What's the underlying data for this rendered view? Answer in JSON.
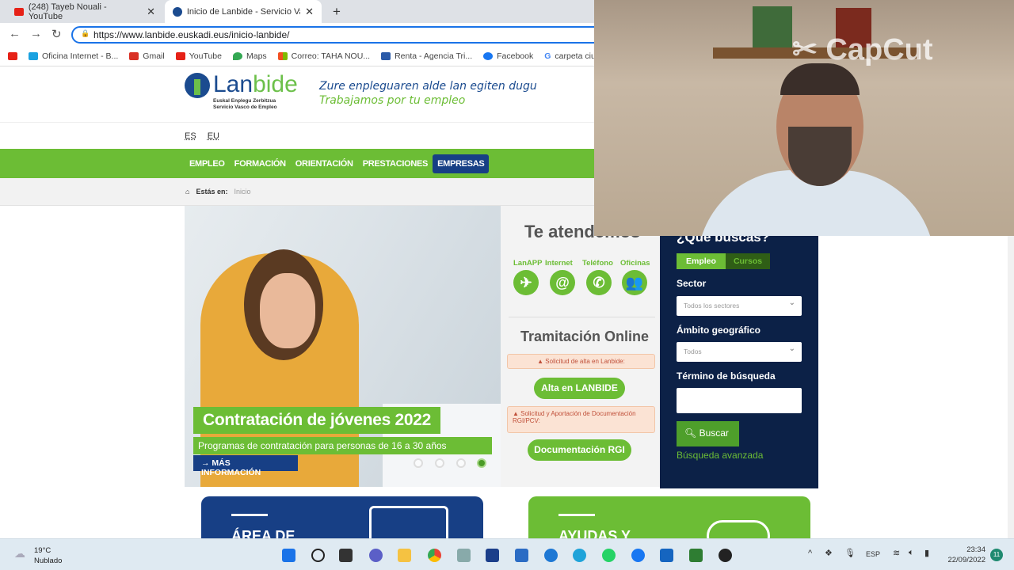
{
  "browser": {
    "tabs": [
      {
        "label": "(248) Tayeb Nouali - YouTube",
        "active": false
      },
      {
        "label": "Inicio de Lanbide - Servicio Vasco",
        "active": true
      }
    ],
    "new_tab": "+",
    "close": "✕",
    "url": "https://www.lanbide.euskadi.eus/inicio-lanbide/",
    "bookmarks": [
      {
        "label": "",
        "color": "#e62117"
      },
      {
        "label": "Oficina Internet - B...",
        "color": "#1aa1e0"
      },
      {
        "label": "Gmail",
        "color": "#d93025"
      },
      {
        "label": "YouTube",
        "color": "#e62117"
      },
      {
        "label": "Maps",
        "color": "#34a853"
      },
      {
        "label": "Correo: TAHA NOU...",
        "color": "#f25022"
      },
      {
        "label": "Renta - Agencia Tri...",
        "color": "#2a5aa8"
      },
      {
        "label": "Facebook",
        "color": "#1877f2"
      },
      {
        "label": "carpeta ciud",
        "color": "#4285f4"
      }
    ]
  },
  "site": {
    "logo": {
      "word1": "Lan",
      "word2": "bide",
      "sub1": "Euskal Enplegu Zerbitzua",
      "sub2": "Servicio Vasco de Empleo"
    },
    "slogan_eu": "Zure enpleguaren alde lan egiten dugu",
    "slogan_es": "Trabajamos por tu empleo",
    "langs": [
      "ES",
      "EU"
    ],
    "nav": [
      "EMPLEO",
      "FORMACIÓN",
      "ORIENTACIÓN",
      "PRESTACIONES",
      "EMPRESAS"
    ],
    "breadcrumb": {
      "label": "Estás en:",
      "current": "Inicio"
    },
    "hero": {
      "title": "Contratación de jóvenes 2022",
      "subtitle": "Programas de contratación para personas de 16 a 30 años",
      "more": "MÁS INFORMACIÓN",
      "slides": 4,
      "active_slide": 4
    },
    "attend": {
      "title": "Te atendemos",
      "channels": [
        "LanAPP",
        "Internet",
        "Teléfono",
        "Oficinas"
      ]
    },
    "online": {
      "title": "Tramitación Online",
      "warn1": "Solicitud de alta en Lanbide:",
      "btn1": "Alta en LANBIDE",
      "warn2": "Solicitud y Aportación de Documentación RGI/PCV:",
      "btn2": "Documentación RGI"
    },
    "search": {
      "title": "¿Qué buscas?",
      "tabs": [
        "Empleo",
        "Cursos"
      ],
      "sector_label": "Sector",
      "sector_value": "Todos los sectores",
      "ambito_label": "Ámbito geográfico",
      "ambito_value": "Todos",
      "term_label": "Término de búsqueda",
      "term_value": "",
      "button": "Buscar",
      "advanced": "Búsqueda avanzada"
    },
    "cards": [
      "ÁREA DE",
      "AYUDAS Y"
    ]
  },
  "webcam": {
    "watermark": "CapCut"
  },
  "taskbar": {
    "temp": "19°C",
    "weather": "Nublado",
    "lang": "ESP",
    "time": "23:34",
    "date": "22/09/2022",
    "badge": "11"
  },
  "colors": {
    "green": "#6cbd35",
    "navy": "#173f85",
    "dark": "#0c2147"
  }
}
